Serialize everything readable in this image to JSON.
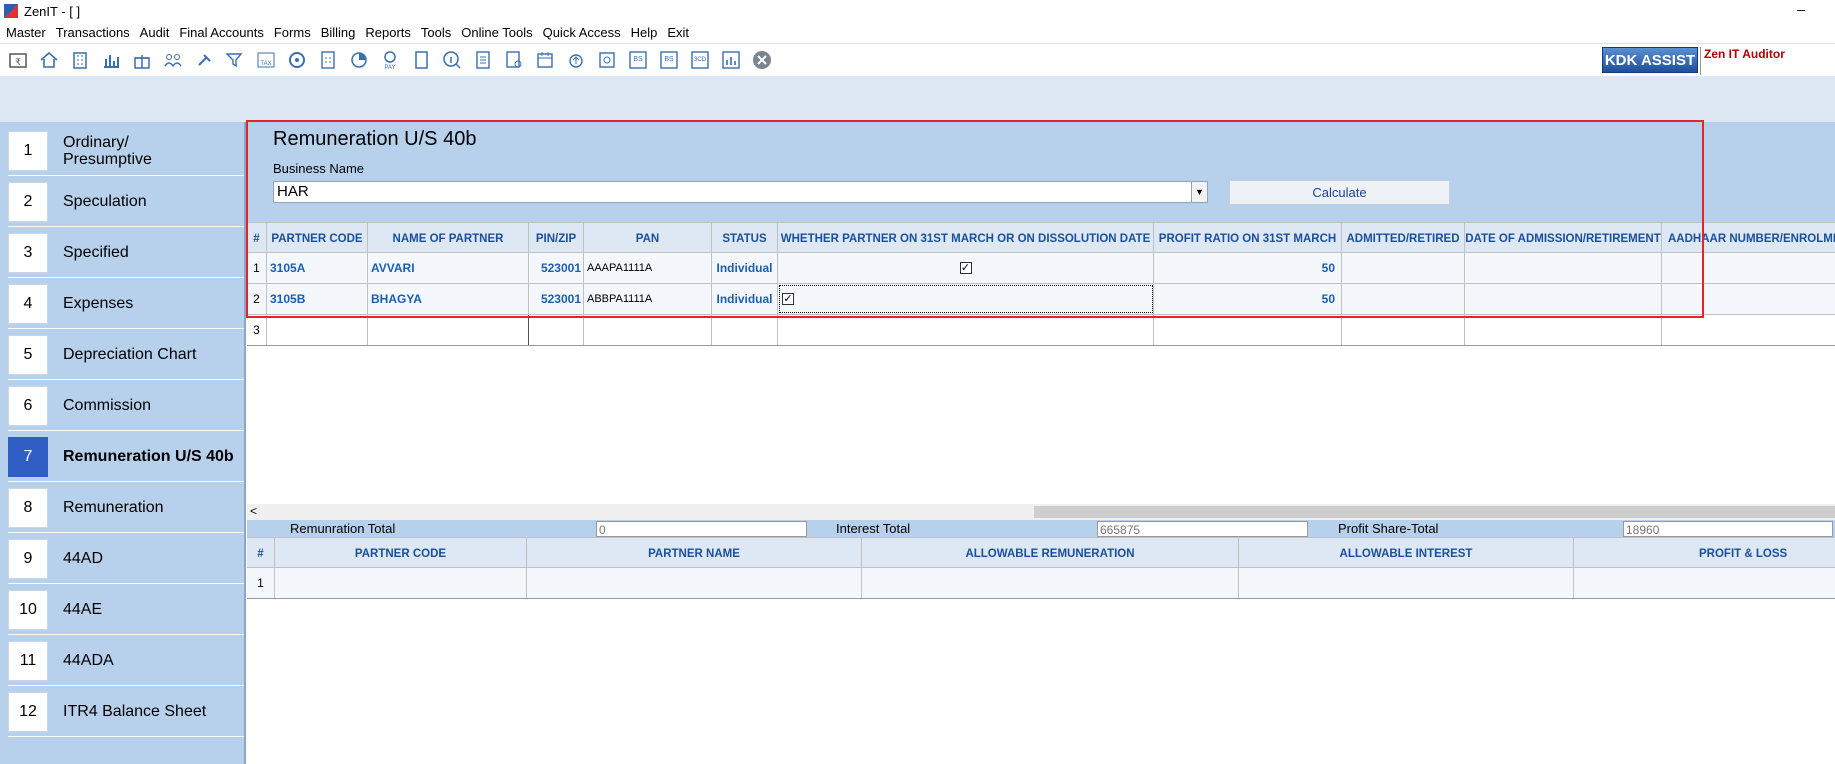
{
  "window": {
    "title": "ZenIT - [ ]",
    "minimize": "–"
  },
  "menu": [
    "Master",
    "Transactions",
    "Audit",
    "Final Accounts",
    "Forms",
    "Billing",
    "Reports",
    "Tools",
    "Online Tools",
    "Quick Access",
    "Help",
    "Exit"
  ],
  "toolbar": {
    "icons": [
      "rupee-book-icon",
      "home-icon",
      "building-icon",
      "bar-chart-icon",
      "gift-icon",
      "users-icon",
      "gavel-icon",
      "filter-icon",
      "tax-icon",
      "refresh-disc-icon",
      "calculator-icon",
      "pie-chart-icon",
      "pay-icon",
      "book-icon",
      "info-icon",
      "form-icon",
      "user-doc-icon",
      "calendar-icon",
      "upload-icon",
      "sync-icon",
      "bs-icon",
      "bs-2-icon",
      "3cd-icon",
      "report-icon",
      "close-circle-icon"
    ],
    "labels": {
      "tax": "TAX",
      "pay": "PAY",
      "bs": "BS",
      "bs2": "BS",
      "cd": "3CD"
    },
    "kdk_assist": "KDK ASSIST",
    "brand": "Zen IT Auditor"
  },
  "sidebar": {
    "items": [
      {
        "num": "1",
        "label": "Ordinary/ Presumptive"
      },
      {
        "num": "2",
        "label": "Speculation"
      },
      {
        "num": "3",
        "label": "Specified"
      },
      {
        "num": "4",
        "label": "Expenses"
      },
      {
        "num": "5",
        "label": "Depreciation Chart"
      },
      {
        "num": "6",
        "label": "Commission"
      },
      {
        "num": "7",
        "label": "Remuneration U/S 40b"
      },
      {
        "num": "8",
        "label": "Remuneration"
      },
      {
        "num": "9",
        "label": "44AD"
      },
      {
        "num": "10",
        "label": "44AE"
      },
      {
        "num": "11",
        "label": "44ADA"
      },
      {
        "num": "12",
        "label": "ITR4 Balance Sheet"
      }
    ],
    "active_index": 6
  },
  "form": {
    "title": "Remuneration U/S 40b",
    "business_label": "Business Name",
    "business_value": "HAR",
    "calculate_label": "Calculate"
  },
  "partners_grid": {
    "headers": [
      "#",
      "PARTNER CODE",
      "NAME OF PARTNER",
      "PIN/ZIP",
      "PAN",
      "STATUS",
      "WHETHER PARTNER ON 31ST MARCH OR ON DISSOLUTION DATE",
      "PROFIT RATIO ON 31ST MARCH",
      "ADMITTED/RETIRED",
      "DATE OF ADMISSION/RETIREMENT",
      "AADHAAR NUMBER/ENROLMENT"
    ],
    "rows": [
      {
        "n": "1",
        "code": "3105A",
        "name": "AVVARI",
        "pin": "523001",
        "pan": "AAAPA1111A",
        "status": "Individual",
        "partner_on_date": true,
        "ratio": "50"
      },
      {
        "n": "2",
        "code": "3105B",
        "name": "BHAGYA",
        "pin": "523001",
        "pan": "ABBPA1111A",
        "status": "Individual",
        "partner_on_date": true,
        "ratio": "50"
      },
      {
        "n": "3",
        "code": "",
        "name": "",
        "pin": "",
        "pan": "",
        "status": "",
        "partner_on_date": false,
        "ratio": ""
      }
    ]
  },
  "scroll": {
    "left_arrow": "<"
  },
  "totals": {
    "remuneration_label": "Remunration Total",
    "remuneration_value": "0",
    "interest_label": "Interest Total",
    "interest_value": "665875",
    "profit_share_label": "Profit Share-Total",
    "profit_share_value": "18960"
  },
  "allowance_grid": {
    "headers": [
      "#",
      "PARTNER CODE",
      "PARTNER NAME",
      "ALLOWABLE REMUNERATION",
      "ALLOWABLE INTEREST",
      "PROFIT &  LOSS"
    ],
    "rows": [
      {
        "n": "1"
      }
    ]
  }
}
